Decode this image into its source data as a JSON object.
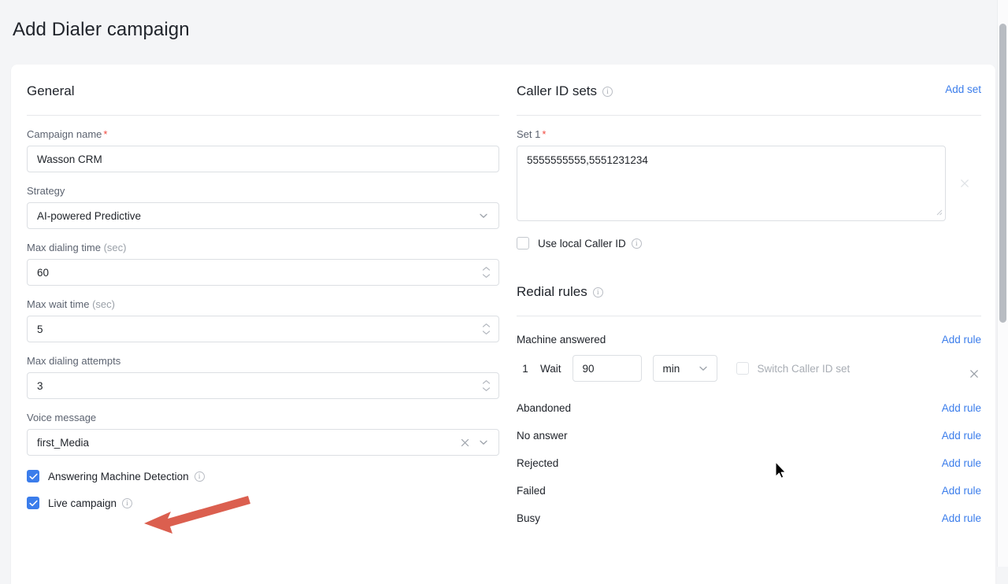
{
  "page": {
    "title": "Add Dialer campaign"
  },
  "general": {
    "heading": "General",
    "campaign_name": {
      "label": "Campaign name",
      "required_mark": "*",
      "value": "Wasson CRM"
    },
    "strategy": {
      "label": "Strategy",
      "value": "AI-powered Predictive"
    },
    "max_dialing_time": {
      "label": "Max dialing time",
      "unit": "(sec)",
      "value": "60"
    },
    "max_wait_time": {
      "label": "Max wait time",
      "unit": "(sec)",
      "value": "5"
    },
    "max_dialing_attempts": {
      "label": "Max dialing attempts",
      "value": "3"
    },
    "voice_message": {
      "label": "Voice message",
      "value": "first_Media"
    },
    "amd_checkbox": {
      "label": "Answering Machine Detection",
      "checked": true
    },
    "live_campaign_checkbox": {
      "label": "Live campaign",
      "checked": true
    }
  },
  "caller_id_sets": {
    "heading": "Caller ID sets",
    "add_set_label": "Add set",
    "set1": {
      "label": "Set 1",
      "required_mark": "*",
      "value": "5555555555,5551231234"
    },
    "use_local_caller_id": {
      "label": "Use local Caller ID",
      "checked": false
    }
  },
  "redial_rules": {
    "heading": "Redial rules",
    "add_rule_label": "Add rule",
    "groups": [
      {
        "name": "Machine answered",
        "rows": [
          {
            "index": "1",
            "wait_label": "Wait",
            "amount": "90",
            "unit": "min",
            "switch_label": "Switch Caller ID set",
            "switch_checked": false
          }
        ]
      },
      {
        "name": "Abandoned",
        "rows": []
      },
      {
        "name": "No answer",
        "rows": []
      },
      {
        "name": "Rejected",
        "rows": []
      },
      {
        "name": "Failed",
        "rows": []
      },
      {
        "name": "Busy",
        "rows": []
      }
    ]
  },
  "colors": {
    "accent_link": "#3b7deb",
    "checkbox_checked": "#3b7deb",
    "required_asterisk": "#f0483e",
    "annotation_arrow": "#db5f4f",
    "page_background": "#f4f5f7",
    "card_background": "#ffffff"
  }
}
